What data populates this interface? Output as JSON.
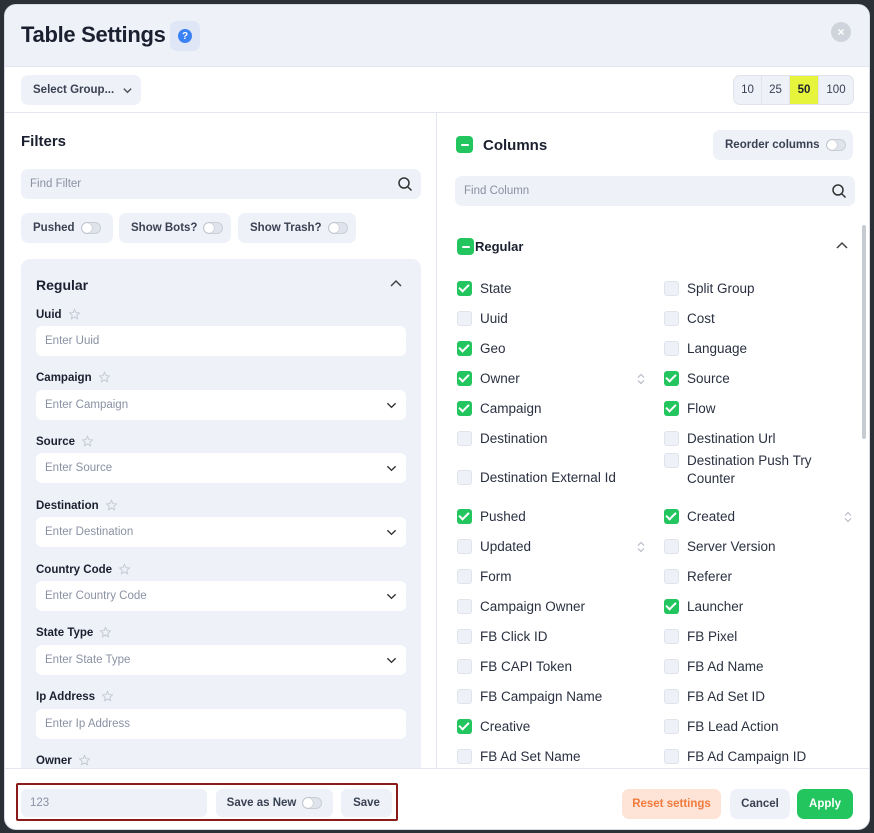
{
  "header": {
    "title": "Table Settings",
    "help_icon": "question-icon",
    "close_icon": "close-icon"
  },
  "toolbar": {
    "select_group_label": "Select Group...",
    "page_sizes": [
      "10",
      "25",
      "50",
      "100"
    ],
    "active_page_size": "50"
  },
  "filters": {
    "title": "Filters",
    "search_placeholder": "Find Filter",
    "toggles": [
      {
        "label": "Pushed",
        "on": false
      },
      {
        "label": "Show Bots?",
        "on": false
      },
      {
        "label": "Show Trash?",
        "on": false
      }
    ],
    "group_title": "Regular",
    "fields": [
      {
        "label": "Uuid",
        "placeholder": "Enter Uuid",
        "dropdown": false
      },
      {
        "label": "Campaign",
        "placeholder": "Enter Campaign",
        "dropdown": true
      },
      {
        "label": "Source",
        "placeholder": "Enter Source",
        "dropdown": true
      },
      {
        "label": "Destination",
        "placeholder": "Enter Destination",
        "dropdown": true
      },
      {
        "label": "Country Code",
        "placeholder": "Enter Country Code",
        "dropdown": true
      },
      {
        "label": "State Type",
        "placeholder": "Enter State Type",
        "dropdown": true
      },
      {
        "label": "Ip Address",
        "placeholder": "Enter Ip Address",
        "dropdown": false
      },
      {
        "label": "Owner",
        "placeholder": "",
        "dropdown": false
      }
    ]
  },
  "columns": {
    "title": "Columns",
    "reorder_label": "Reorder columns",
    "search_placeholder": "Find Column",
    "group_title": "Regular",
    "left": [
      {
        "label": "State",
        "checked": true
      },
      {
        "label": "Uuid",
        "checked": false
      },
      {
        "label": "Geo",
        "checked": true
      },
      {
        "label": "Owner",
        "checked": true,
        "sortable": true
      },
      {
        "label": "Campaign",
        "checked": true
      },
      {
        "label": "Destination",
        "checked": false
      },
      {
        "label": "Destination External Id",
        "checked": false
      },
      {
        "label": "Pushed",
        "checked": true
      },
      {
        "label": "Updated",
        "checked": false,
        "sortable": true
      },
      {
        "label": "Form",
        "checked": false
      },
      {
        "label": "Campaign Owner",
        "checked": false
      },
      {
        "label": "FB Click ID",
        "checked": false
      },
      {
        "label": "FB CAPI Token",
        "checked": false
      },
      {
        "label": "FB Campaign Name",
        "checked": false
      },
      {
        "label": "Creative",
        "checked": true
      },
      {
        "label": "FB Ad Set Name",
        "checked": false
      }
    ],
    "right": [
      {
        "label": "Split Group",
        "checked": false
      },
      {
        "label": "Cost",
        "checked": false
      },
      {
        "label": "Language",
        "checked": false
      },
      {
        "label": "Source",
        "checked": true
      },
      {
        "label": "Flow",
        "checked": true
      },
      {
        "label": "Destination Url",
        "checked": false
      },
      {
        "label": "Destination Push Try Counter",
        "checked": false
      },
      {
        "label": "Created",
        "checked": true,
        "sortable": true
      },
      {
        "label": "Server Version",
        "checked": false
      },
      {
        "label": "Referer",
        "checked": false
      },
      {
        "label": "Launcher",
        "checked": true
      },
      {
        "label": "FB Pixel",
        "checked": false
      },
      {
        "label": "FB Ad Name",
        "checked": false
      },
      {
        "label": "FB Ad Set ID",
        "checked": false
      },
      {
        "label": "FB Lead Action",
        "checked": false
      },
      {
        "label": "FB Ad Campaign ID",
        "checked": false
      }
    ]
  },
  "footer": {
    "preset_name_value": "123",
    "save_as_new_label": "Save as New",
    "save_label": "Save",
    "reset_label": "Reset settings",
    "cancel_label": "Cancel",
    "apply_label": "Apply"
  },
  "colors": {
    "accent_green": "#22c55e",
    "active_page": "#e6f53c",
    "reset_text": "#f07b3f",
    "highlight_border": "#8b1a1a"
  }
}
